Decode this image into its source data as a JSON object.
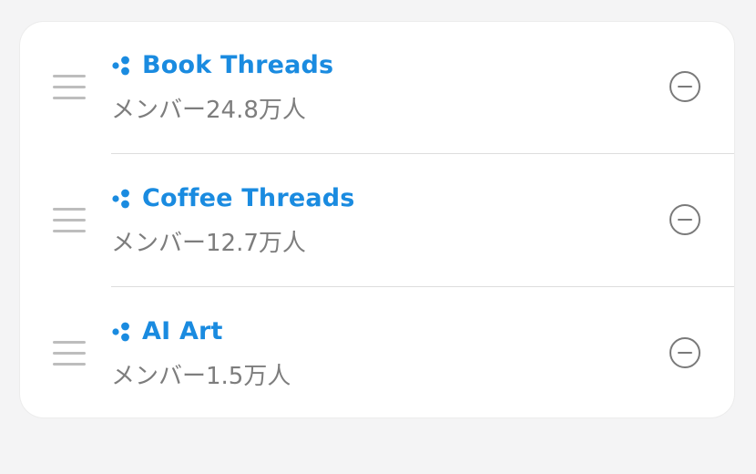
{
  "communities": [
    {
      "name": "Book Threads",
      "members": "メンバー24.8万人",
      "icon": "community-icon"
    },
    {
      "name": "Coffee Threads",
      "members": "メンバー12.7万人",
      "icon": "community-icon"
    },
    {
      "name": "AI Art",
      "members": "メンバー1.5万人",
      "icon": "community-icon"
    }
  ],
  "colors": {
    "accent": "#1a8be0",
    "subtext": "#7d7d7d",
    "icon": "#7a7a7a"
  }
}
